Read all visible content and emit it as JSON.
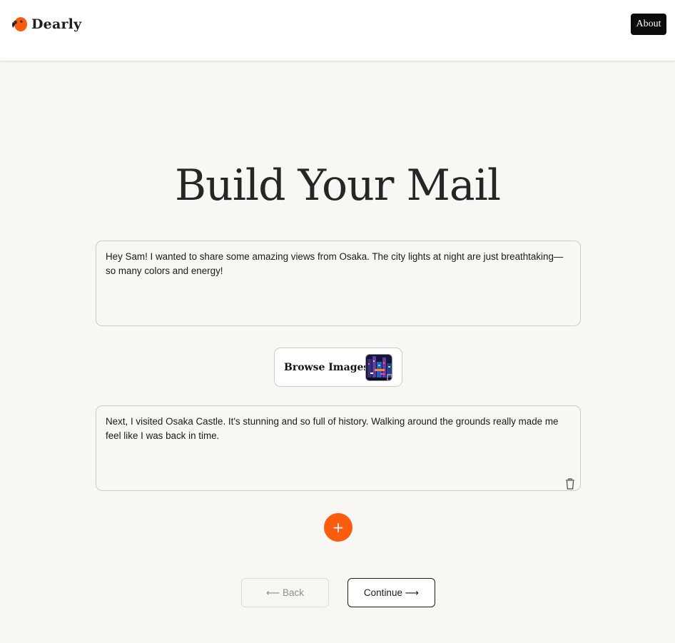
{
  "header": {
    "brand": "Dearly",
    "about_label": "About",
    "logo_icon": "parrot-icon",
    "brand_color": "#fb5c0d"
  },
  "main": {
    "title": "Build Your Mail",
    "blocks": [
      {
        "type": "text",
        "text": "Hey Sam! I wanted to share some amazing views from Osaka. The city lights at night are just breathtaking—so many colors and energy!"
      },
      {
        "type": "image",
        "label": "Browse Images",
        "thumbnail_icon": "osaka-night-thumbnail"
      },
      {
        "type": "text",
        "text": "Next, I visited Osaka Castle. It's stunning and so full of history. Walking around the grounds really made me feel like I was back in time.",
        "delete_icon": "trash-icon"
      }
    ],
    "add_label": "+",
    "accent_color": "#fb5c0d"
  },
  "footer": {
    "back_label": "⟵ Back",
    "continue_label": "Continue ⟶"
  }
}
